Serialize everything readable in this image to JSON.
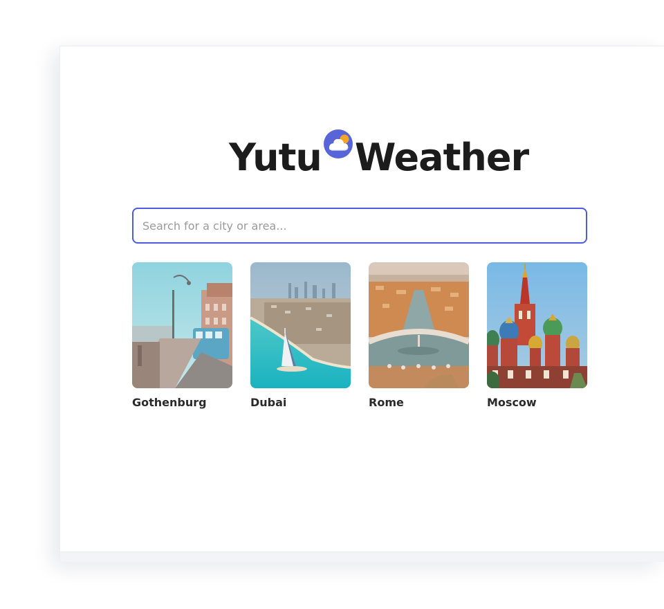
{
  "app": {
    "logo_left": "Yutu",
    "logo_right": "Weather",
    "logo_icon": "cloud-sun-icon"
  },
  "search": {
    "placeholder": "Search for a city or area...",
    "value": ""
  },
  "cities": [
    {
      "name": "Gothenburg",
      "image": "tram-street-photo"
    },
    {
      "name": "Dubai",
      "image": "burj-al-arab-coast-photo"
    },
    {
      "name": "Rome",
      "image": "st-peters-square-photo"
    },
    {
      "name": "Moscow",
      "image": "st-basils-cathedral-photo"
    }
  ],
  "colors": {
    "accent": "#4b5bdc",
    "logo_icon_circle": "#5865d8",
    "logo_icon_sun": "#f5a524",
    "text": "#1c1c1c"
  }
}
